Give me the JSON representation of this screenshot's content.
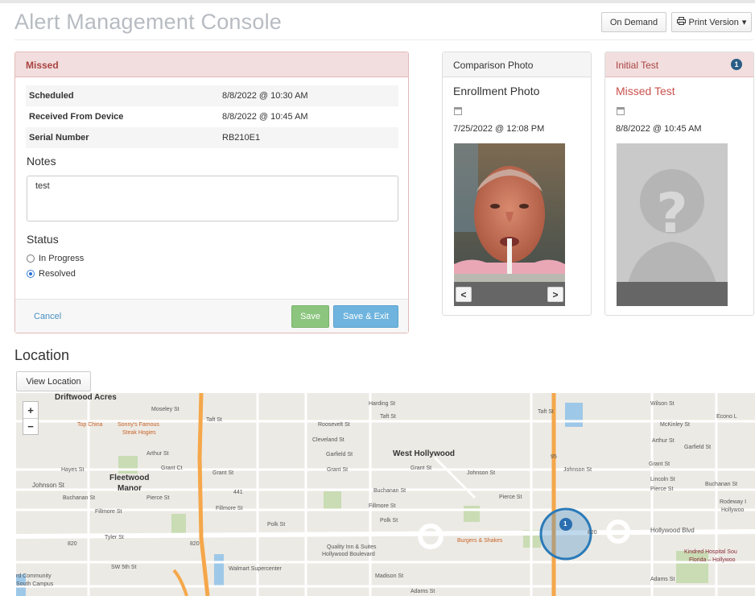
{
  "header": {
    "title": "Alert Management Console",
    "on_demand": "On Demand",
    "print_version": "Print Version",
    "print_icon": "printer-icon",
    "caret_icon": "caret-down-icon"
  },
  "missed_panel": {
    "title": "Missed",
    "rows": [
      {
        "label": "Scheduled",
        "value": "8/8/2022 @ 10:30 AM"
      },
      {
        "label": "Received From Device",
        "value": "8/8/2022 @ 10:45 AM"
      },
      {
        "label": "Serial Number",
        "value": "RB210E1"
      }
    ],
    "notes_label": "Notes",
    "notes_value": "test",
    "status_label": "Status",
    "status_options": [
      {
        "label": "In Progress",
        "checked": false
      },
      {
        "label": "Resolved",
        "checked": true
      }
    ],
    "cancel": "Cancel",
    "save": "Save",
    "save_exit": "Save & Exit"
  },
  "comparison_panel": {
    "title": "Comparison Photo",
    "photo_title": "Enrollment Photo",
    "calendar_icon": "calendar-icon",
    "date": "7/25/2022 @ 12:08 PM",
    "prev": "<",
    "next": ">"
  },
  "initial_panel": {
    "title": "Initial Test",
    "badge": "1",
    "photo_title": "Missed Test",
    "calendar_icon": "calendar-icon",
    "date": "8/8/2022 @ 10:45 AM"
  },
  "location": {
    "heading": "Location",
    "view_button": "View Location",
    "zoom_in": "+",
    "zoom_out": "−",
    "marker": "1",
    "labels": {
      "driftwood": "Driftwood Acres",
      "moseley": "Moseley St",
      "topchina": "Top China",
      "sonnys": "Sonny's Famous",
      "sonnys2": "Steak Hogies",
      "taft1": "Taft St",
      "roosevelt": "Roosevelt St",
      "cleveland": "Cleveland St",
      "garfield": "Garfield St",
      "harding": "Harding St",
      "taft2": "Taft St",
      "west_hollywood": "West Hollywood",
      "grant1": "Grant St",
      "grant2": "Grant St",
      "grantct": "Grant Ct",
      "arthur": "Arthur St",
      "hayes": "Hayes St",
      "johnson1": "Johnson St",
      "fleetwood": "Fleetwood",
      "manor": "Manor",
      "buchanan1": "Buchanan St",
      "pierce1": "Pierce St",
      "fillmore1": "Fillmore St",
      "fillmore2": "Fillmore St",
      "fillmore3": "Fillmore St",
      "tyler": "Tyler St",
      "polk1": "Polk St",
      "polk2": "Polk St",
      "buchanan2": "Buchanan St",
      "johnson2": "Johnson St",
      "johnson3": "Johnson St",
      "pierce2": "Pierce St",
      "quality": "Quality Inn & Suites",
      "quality2": "Hollywood Boulevard",
      "madison": "Madison St",
      "adams1": "Adams St",
      "adams2": "Adams St",
      "walmart": "Walmart Supercenter",
      "sw5th": "SW 5th St",
      "community": "rd Community",
      "southcampus": "South Campus",
      "burgers": "Burgers & Shakes",
      "wilson": "Wilson St",
      "mckinley": "McKinley St",
      "arthur2": "Arthur St",
      "garfield2": "Garfield St",
      "grant3": "Grant St",
      "lincoln": "Lincoln St",
      "pierce3": "Pierce St",
      "buchanan3": "Buchanan St",
      "hollywood_blvd": "Hollywood Blvd",
      "kindred": "Kindred Hospital Sou",
      "kindred2": "Florida – Hollywoo",
      "econo": "Econo L",
      "rodeway": "Rodeway I",
      "rodeway2": "Hollywoo",
      "taft3": "Taft St",
      "hwy441": "441",
      "hwy820a": "820",
      "hwy820b": "820",
      "i95": "95",
      "hwy820c": "820"
    }
  }
}
